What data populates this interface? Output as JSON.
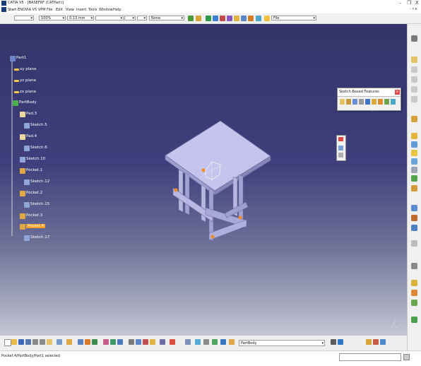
{
  "window": {
    "title": "CATIA V5 - [BASEFRF (CATPart)]",
    "minimize": "–",
    "restore": "❐",
    "close": "X",
    "right_corner": "- ♯ x"
  },
  "menu": [
    "Start",
    "ENOVIA V5 VPM",
    "File",
    "Edit",
    "View",
    "Insert",
    "Tools",
    "Window",
    "Help"
  ],
  "toolbar": {
    "zoom": "100%",
    "line1": "0.13 mm",
    "layer": "None",
    "filter": "File"
  },
  "tree": {
    "root": "Part1",
    "items": [
      {
        "id": "xy",
        "label": "xy plane"
      },
      {
        "id": "yz",
        "label": "yz plane"
      },
      {
        "id": "zx",
        "label": "zx plane"
      },
      {
        "id": "partbody",
        "label": "PartBody"
      },
      {
        "id": "pad3",
        "label": "Pad.3"
      },
      {
        "id": "sketch5",
        "label": "Sketch.5"
      },
      {
        "id": "pad4",
        "label": "Pad.4"
      },
      {
        "id": "sketch6",
        "label": "Sketch.6"
      },
      {
        "id": "sketch10",
        "label": "Sketch.10"
      },
      {
        "id": "pocket1",
        "label": "Pocket.1"
      },
      {
        "id": "sketch12",
        "label": "Sketch.12"
      },
      {
        "id": "pocket2",
        "label": "Pocket.2"
      },
      {
        "id": "sketch15",
        "label": "Sketch.15"
      },
      {
        "id": "pocket3",
        "label": "Pocket.3"
      },
      {
        "id": "pocket4",
        "label": "Pocket.4"
      },
      {
        "id": "sketch17",
        "label": "Sketch.17"
      }
    ]
  },
  "sketch_features": {
    "title": "Sketch-Based Features",
    "close": "x"
  },
  "bottom": {
    "current_body": "PartBody"
  },
  "status": {
    "text": "Pocket.4/PartBody/Part1 selected"
  }
}
